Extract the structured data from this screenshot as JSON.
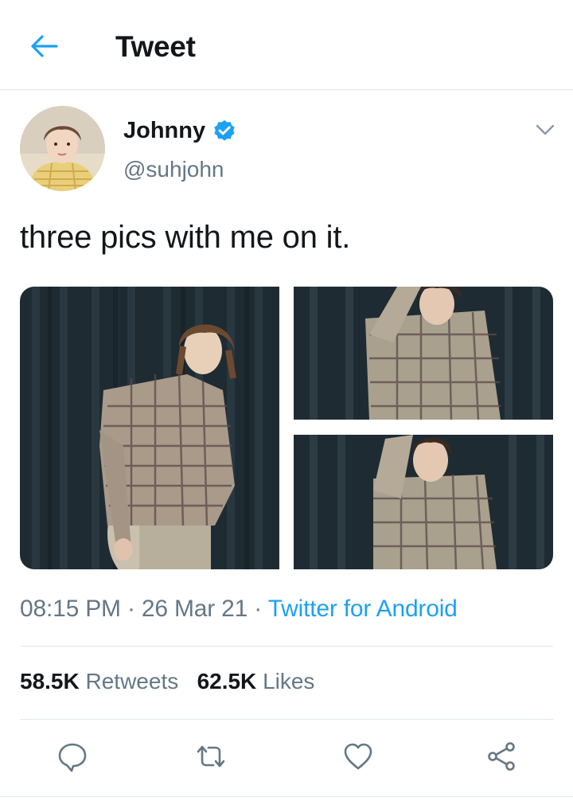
{
  "header": {
    "title": "Tweet"
  },
  "author": {
    "name": "Johnny",
    "handle": "@suhjohn"
  },
  "tweet": {
    "text": "three pics with me on it."
  },
  "meta": {
    "time": "08:15 PM",
    "separator": " · ",
    "date": "26 Mar 21",
    "source": "Twitter for Android"
  },
  "stats": {
    "retweets_count": "58.5K",
    "retweets_label": "Retweets",
    "likes_count": "62.5K",
    "likes_label": "Likes"
  },
  "colors": {
    "accent": "#1da1f2",
    "secondary_text": "#657786",
    "divider": "#e1e8ed"
  },
  "icons": [
    "back-arrow-icon",
    "verified-badge-icon",
    "chevron-down-icon",
    "reply-icon",
    "retweet-icon",
    "like-icon",
    "share-icon"
  ]
}
